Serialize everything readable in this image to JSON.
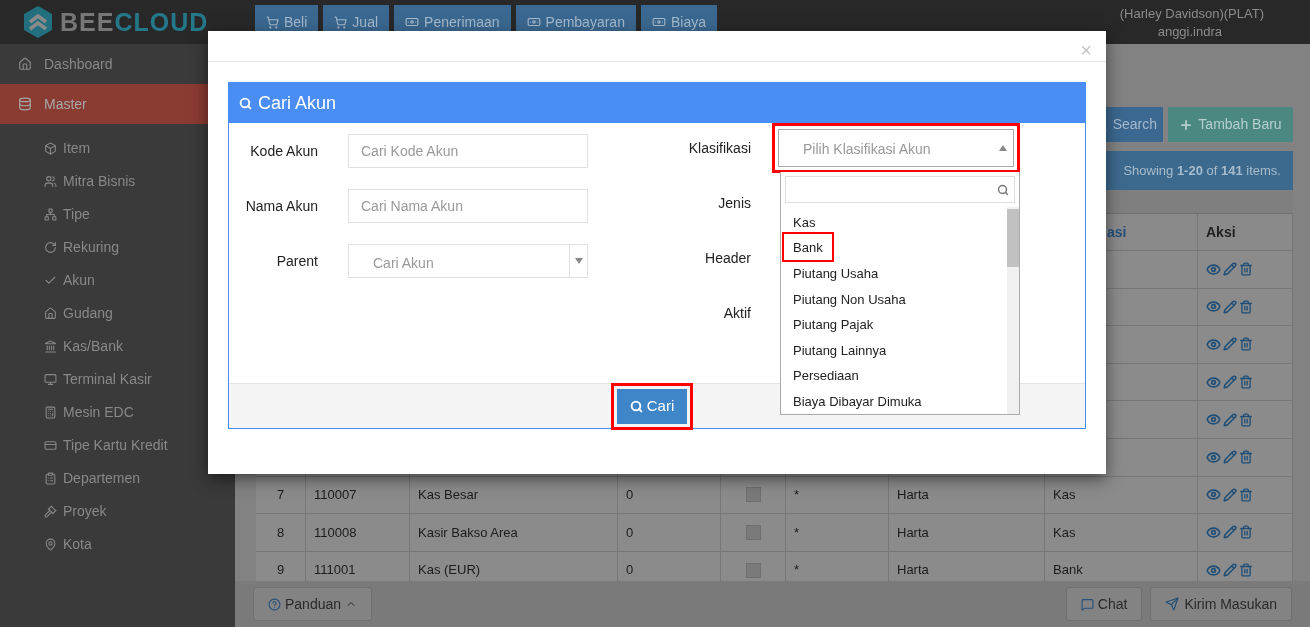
{
  "top_bar": {
    "logo": [
      "BEE",
      "CLOUD"
    ],
    "nav": [
      {
        "label": "Beli",
        "kind": "cart"
      },
      {
        "label": "Jual",
        "kind": "cart"
      },
      {
        "label": "Penerimaan",
        "kind": "money"
      },
      {
        "label": "Pembayaran",
        "kind": "money"
      },
      {
        "label": "Biaya",
        "kind": "money"
      }
    ],
    "company": "(Harley Davidson)(PLAT)",
    "user": "anggi.indra"
  },
  "sidebar": {
    "items": [
      {
        "label": "Dashboard",
        "selected": false
      },
      {
        "label": "Master",
        "selected": true,
        "children": [
          {
            "label": "Item"
          },
          {
            "label": "Mitra Bisnis"
          },
          {
            "label": "Tipe"
          },
          {
            "label": "Rekuring"
          },
          {
            "label": "Akun"
          },
          {
            "label": "Gudang"
          },
          {
            "label": "Kas/Bank"
          },
          {
            "label": "Terminal Kasir"
          },
          {
            "label": "Mesin EDC"
          },
          {
            "label": "Tipe Kartu Kredit"
          },
          {
            "label": "Departemen"
          },
          {
            "label": "Proyek"
          },
          {
            "label": "Kota"
          }
        ]
      }
    ]
  },
  "toolbar": {
    "buttons": [
      {
        "label": "Search",
        "kind": "search"
      },
      {
        "label": "Tambah Baru",
        "kind": "add"
      }
    ]
  },
  "table": {
    "summary": "Showing **1-20** of **141** items.",
    "columns": [
      "asi",
      "Aksi"
    ],
    "rows": [
      {},
      {},
      {},
      {},
      {},
      {},
      {
        "checked": false,
        "cells": [
          "7",
          "110007",
          "Kas Besar",
          "0",
          "*",
          "Harta",
          "Kas"
        ]
      },
      {
        "checked": false,
        "cells": [
          "8",
          "110008",
          "Kasir Bakso Area",
          "0",
          "*",
          "Harta",
          "Kas"
        ]
      },
      {
        "checked": false,
        "cells": [
          "9",
          "111001",
          "Kas (EUR)",
          "0",
          "*",
          "Harta",
          "Bank"
        ]
      }
    ]
  },
  "bottom_bar": {
    "guide": "Panduan",
    "chat": "Chat",
    "feedback": "Kirim Masukan"
  },
  "modal": {
    "close": "×",
    "panel": {
      "title": "Cari Akun",
      "left_fields": [
        {
          "label": "Kode Akun",
          "kind": "text",
          "placeholder": "Cari Kode Akun"
        },
        {
          "label": "Nama Akun",
          "kind": "text",
          "placeholder": "Cari Nama Akun"
        },
        {
          "label": "Parent",
          "kind": "select",
          "placeholder": "Cari Akun"
        }
      ],
      "right_fields": [
        {
          "label": "Klasifikasi",
          "kind": "select",
          "placeholder": "Pilih Klasifikasi Akun",
          "expanded": true,
          "highlighted": true
        },
        {
          "label": "Jenis",
          "kind": "covered"
        },
        {
          "label": "Header",
          "kind": "covered"
        },
        {
          "label": "Aktif",
          "kind": "covered"
        }
      ],
      "options": [
        {
          "label": "Kas",
          "highlighted": false
        },
        {
          "label": "Bank",
          "highlighted": true
        },
        {
          "label": "Piutang Usaha",
          "highlighted": false
        },
        {
          "label": "Piutang Non Usaha",
          "highlighted": false
        },
        {
          "label": "Piutang Pajak",
          "highlighted": false
        },
        {
          "label": "Piutang Lainnya",
          "highlighted": false
        },
        {
          "label": "Persediaan",
          "highlighted": false
        },
        {
          "label": "Biaya Dibayar Dimuka",
          "highlighted": false
        }
      ],
      "submit": {
        "label": "Cari",
        "highlighted": true
      }
    }
  }
}
